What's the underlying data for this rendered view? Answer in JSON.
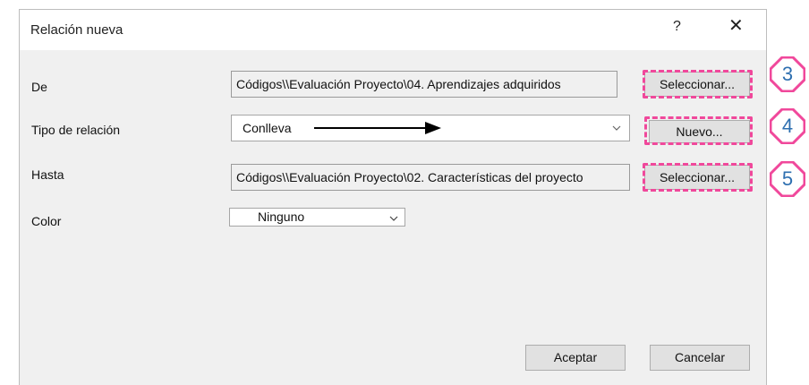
{
  "dialog": {
    "title": "Relación nueva",
    "help": "?",
    "close": "✕"
  },
  "de": {
    "label": "De",
    "value": "Códigos\\\\Evaluación Proyecto\\04. Aprendizajes adquiridos",
    "button": "Seleccionar..."
  },
  "tipo": {
    "label": "Tipo de relación",
    "value": "Conlleva",
    "button": "Nuevo..."
  },
  "hasta": {
    "label": "Hasta",
    "value": "Códigos\\\\Evaluación Proyecto\\02. Características del proyecto",
    "button": "Seleccionar..."
  },
  "color": {
    "label": "Color",
    "value": "Ninguno"
  },
  "footer": {
    "accept": "Aceptar",
    "cancel": "Cancelar"
  },
  "callouts": [
    "3",
    "4",
    "5"
  ],
  "colors": {
    "highlight": "#f0489b",
    "badge_text": "#2e6fb0",
    "dialog_bg": "#f0f0f0"
  }
}
